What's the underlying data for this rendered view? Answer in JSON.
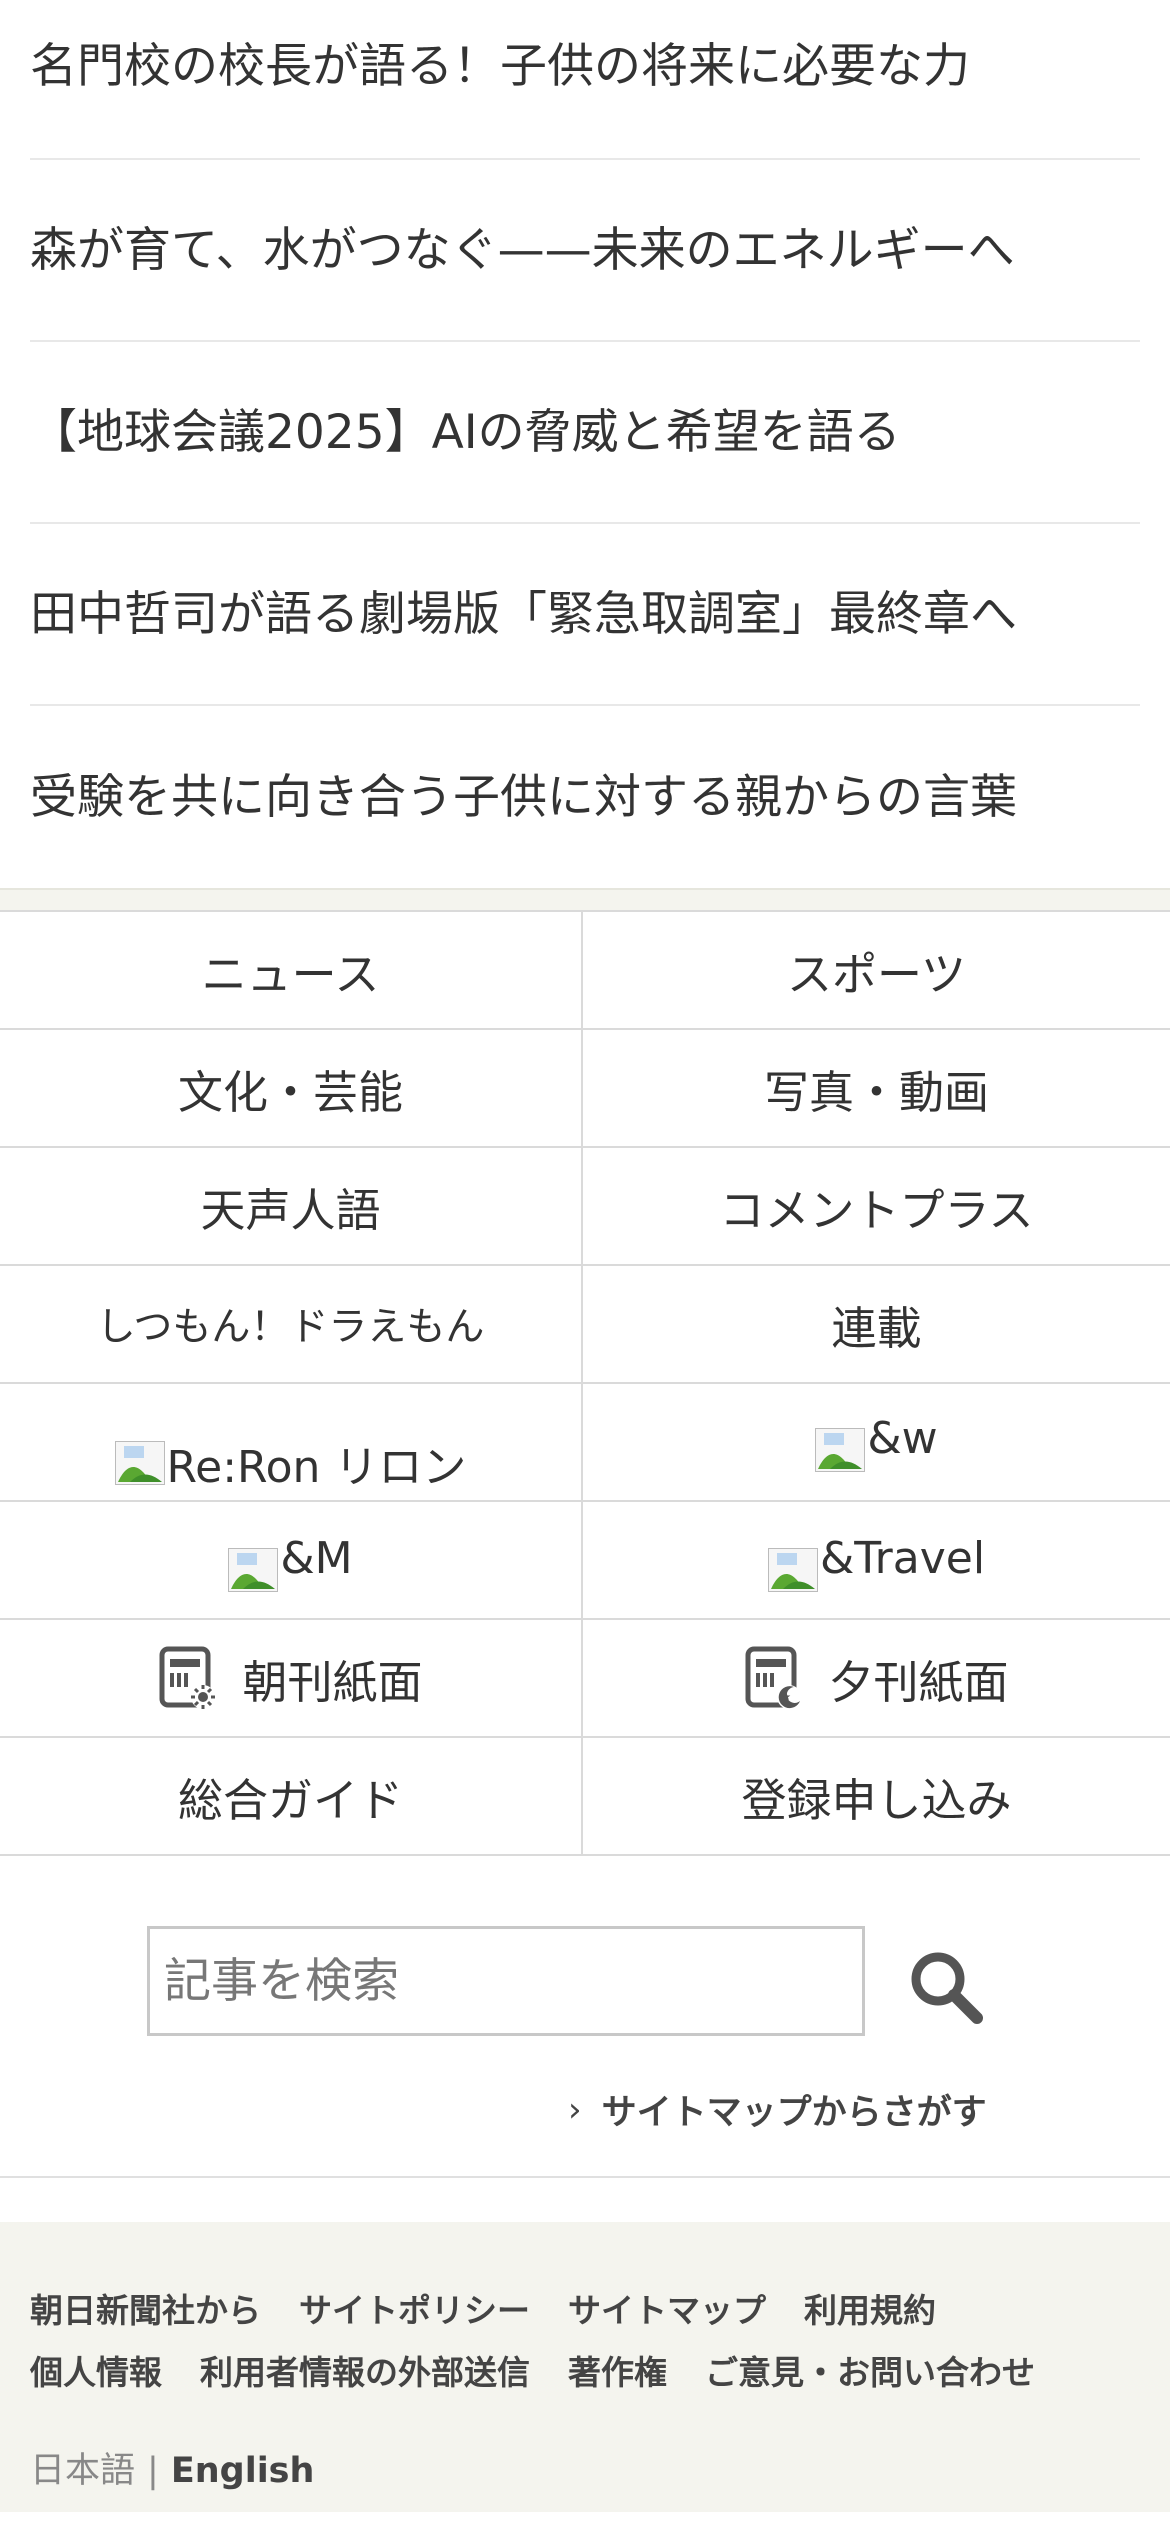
{
  "articles": [
    "名門校の校長が語る！子供の将来に必要な力",
    "森が育て、水がつなぐ——未来のエネルギーへ",
    "【地球会議2025】AIの脅威と希望を語る",
    "田中哲司が語る劇場版「緊急取調室」最終章へ",
    "受験を共に向き合う子供に対する親からの言葉"
  ],
  "menu": {
    "news": "ニュース",
    "sports": "スポーツ",
    "culture": "文化・芸能",
    "photo_video": "写真・動画",
    "tenseijingo": "天声人語",
    "comment_plus": "コメントプラス",
    "shitsumon": "しつもん！ドラえもん",
    "rensai": "連載",
    "reron": "Re:Ron リロン",
    "and_w": "&w",
    "and_m": "&M",
    "and_travel": "&Travel",
    "morning_paper": "朝刊紙面",
    "evening_paper": "夕刊紙面",
    "guide": "総合ガイド",
    "register": "登録申し込み"
  },
  "search": {
    "placeholder": "記事を検索",
    "sitemap_link": "サイトマップからさがす"
  },
  "footer": {
    "links": [
      "朝日新聞社から",
      "サイトポリシー",
      "サイトマップ",
      "利用規約",
      "個人情報",
      "利用者情報の外部送信",
      "著作権",
      "ご意見・お問い合わせ"
    ],
    "lang_ja": "日本語",
    "lang_sep": "|",
    "lang_en": "English"
  },
  "colors": {
    "text": "#333333",
    "footer_bg": "#f4f4ee",
    "border": "#dadada"
  },
  "icons": [
    "broken-image-icon",
    "morning-paper-icon",
    "evening-paper-icon",
    "search-icon",
    "chevron-right-icon"
  ]
}
